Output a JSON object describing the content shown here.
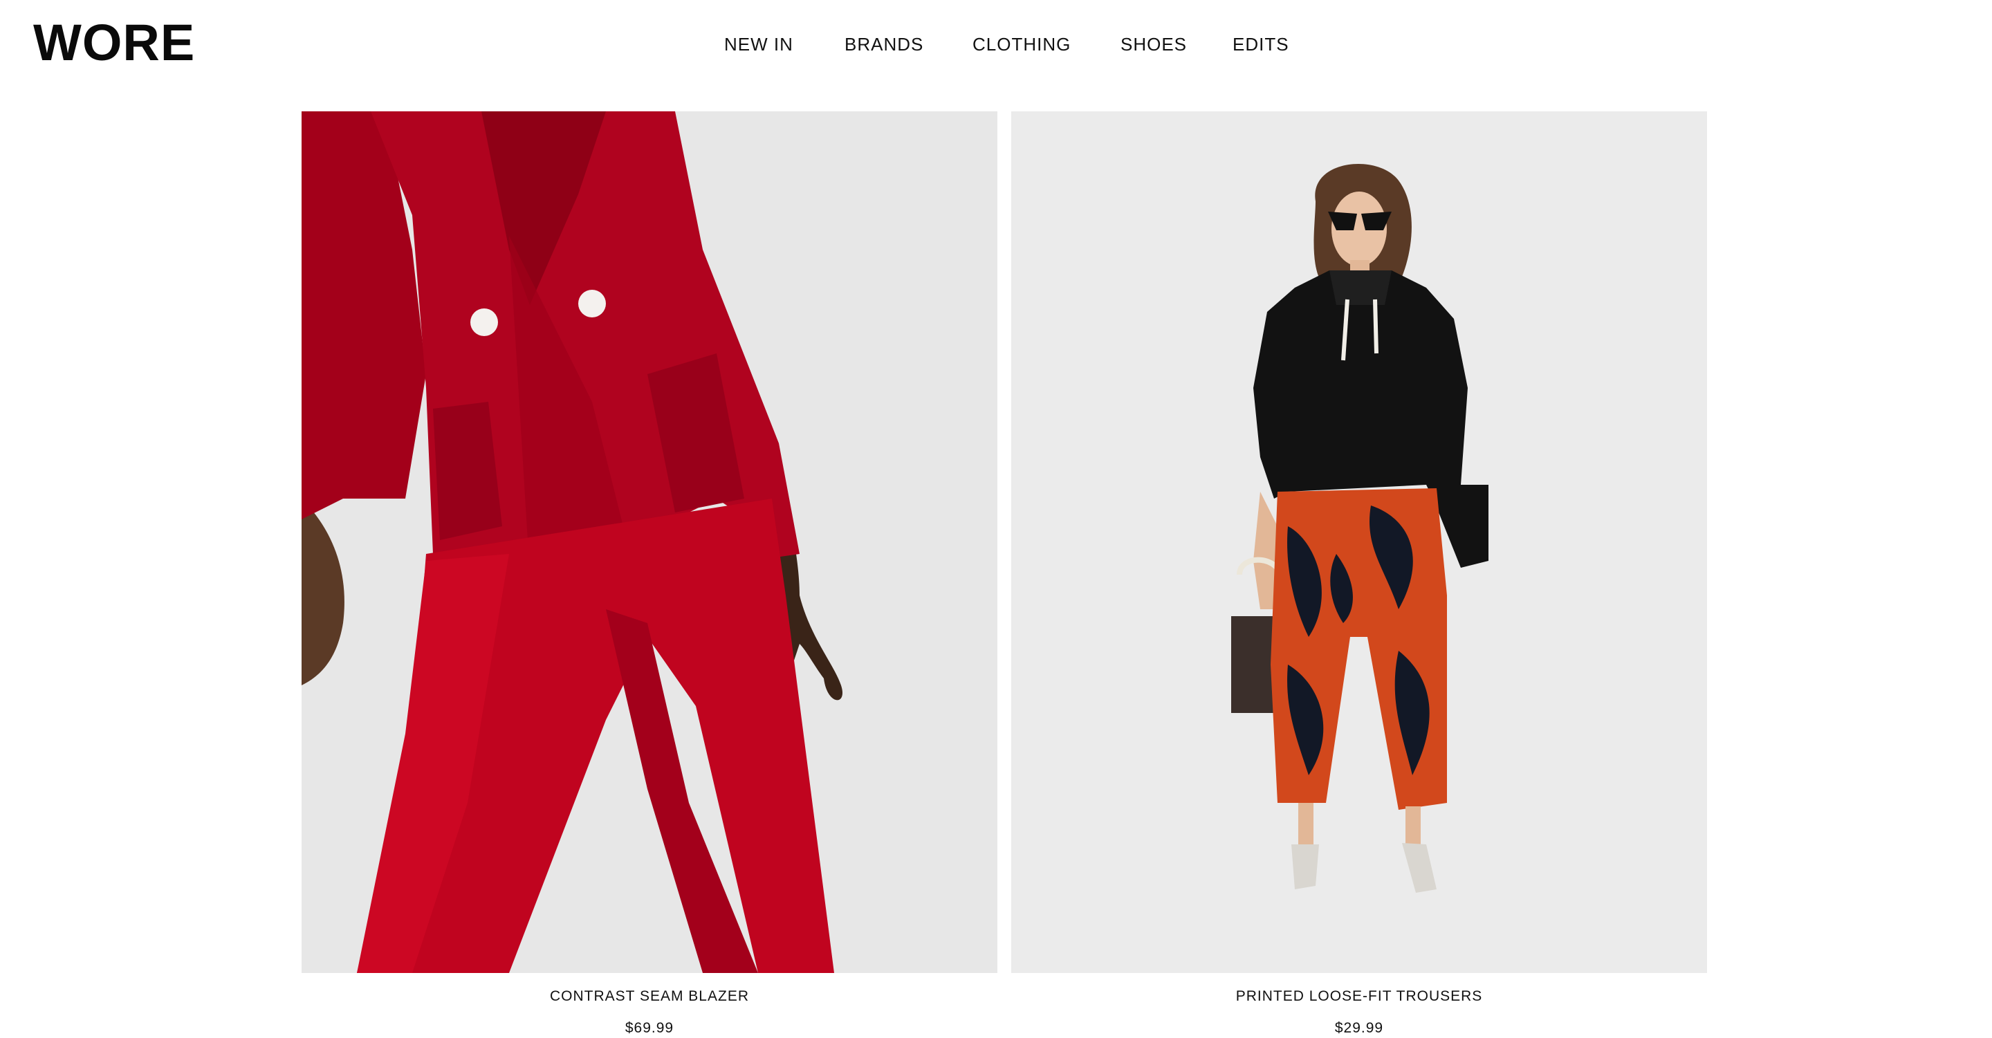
{
  "brand": {
    "logo": "WORE"
  },
  "nav": {
    "items": [
      {
        "label": "NEW IN"
      },
      {
        "label": "BRANDS"
      },
      {
        "label": "CLOTHING"
      },
      {
        "label": "SHOES"
      },
      {
        "label": "EDITS"
      }
    ]
  },
  "products": [
    {
      "name": "CONTRAST SEAM BLAZER",
      "price": "$69.99"
    },
    {
      "name": "PRINTED LOOSE-FIT TROUSERS",
      "price": "$29.99"
    }
  ],
  "colors": {
    "blazer_red": "#a8001b",
    "photo_bg": "#e6e6e6",
    "hoodie_black": "#111111",
    "print_orange": "#d2481c"
  }
}
